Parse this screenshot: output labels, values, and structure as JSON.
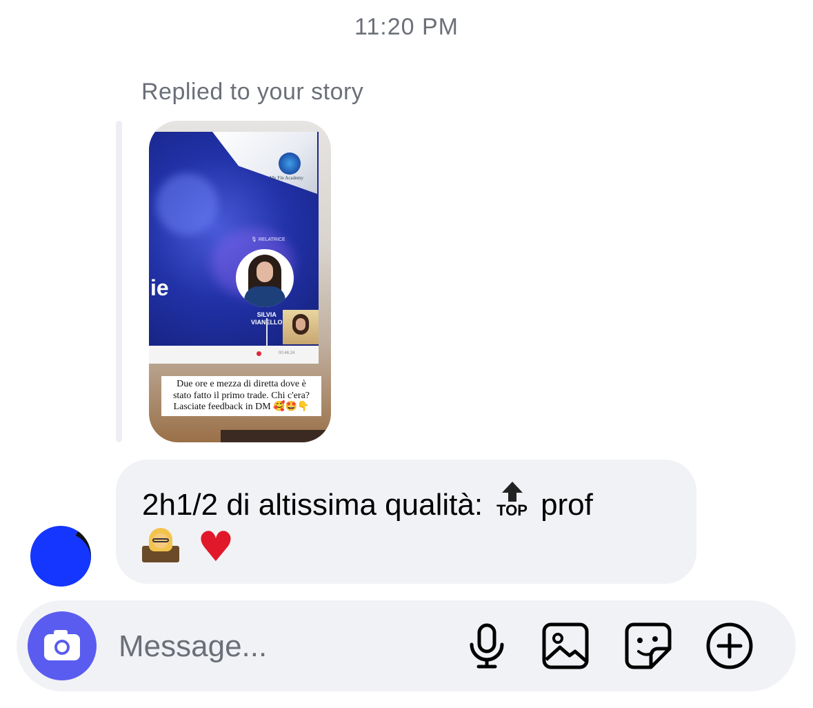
{
  "header": {
    "timestamp": "11:20 PM"
  },
  "reply": {
    "label": "Replied to your story",
    "story": {
      "logo_text": "My Fin Academy",
      "speaker_role": "RELATRICE",
      "speaker_name_1": "SILVIA",
      "speaker_name_2": "VIANELLO",
      "partial_title": "ie",
      "timer": "00:46:24",
      "caption_line_1": "Due ore e mezza di diretta dove è",
      "caption_line_2": "stato fatto il primo trade. Chi c'era?",
      "caption_line_3": "Lasciate feedback in DM 🥰🤩👇"
    }
  },
  "message": {
    "text_before": "2h1/2 di altissima qualità:",
    "top_emoji_label": "TOP",
    "text_after": "prof",
    "emoji_names": [
      "top-arrow-icon",
      "teacher-icon",
      "heart-icon"
    ],
    "heart": "♥"
  },
  "composer": {
    "placeholder": "Message...",
    "icons": [
      "camera-icon",
      "microphone-icon",
      "image-icon",
      "sticker-icon",
      "add-icon"
    ],
    "accent": "#5a5cf0"
  },
  "colors": {
    "bubble": "#f1f2f5",
    "secondary_text": "#6b6f78",
    "avatar": "#1436ff"
  }
}
